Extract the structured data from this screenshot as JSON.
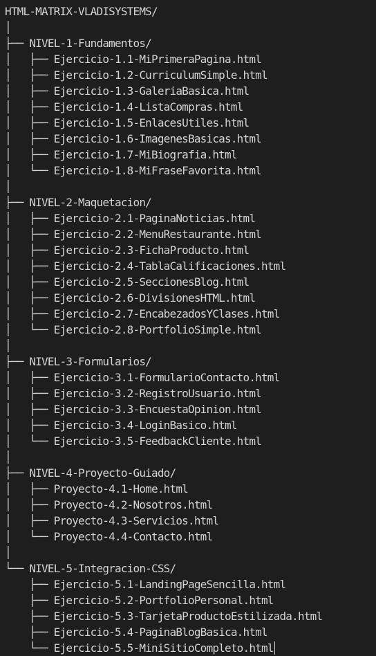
{
  "editor": {
    "theme_background": "#1e1e1e",
    "text_color": "#d4d4d4"
  },
  "tree": {
    "root": "HTML-MATRIX-VLADISYSTEMS/",
    "lines": [
      {
        "kind": "spacer",
        "text": "│"
      },
      {
        "kind": "folder",
        "text": "├── NIVEL-1-Fundamentos/"
      },
      {
        "kind": "file",
        "text": "│   ├── Ejercicio-1.1-MiPrimeraPagina.html"
      },
      {
        "kind": "file",
        "text": "│   ├── Ejercicio-1.2-CurriculumSimple.html"
      },
      {
        "kind": "file",
        "text": "│   ├── Ejercicio-1.3-GaleriaBasica.html"
      },
      {
        "kind": "file",
        "text": "│   ├── Ejercicio-1.4-ListaCompras.html"
      },
      {
        "kind": "file",
        "text": "│   ├── Ejercicio-1.5-EnlacesUtiles.html"
      },
      {
        "kind": "file",
        "text": "│   ├── Ejercicio-1.6-ImagenesBasicas.html"
      },
      {
        "kind": "file",
        "text": "│   ├── Ejercicio-1.7-MiBiografia.html"
      },
      {
        "kind": "file",
        "text": "│   └── Ejercicio-1.8-MiFraseFavorita.html"
      },
      {
        "kind": "spacer",
        "text": "│"
      },
      {
        "kind": "folder",
        "text": "├── NIVEL-2-Maquetacion/"
      },
      {
        "kind": "file",
        "text": "│   ├── Ejercicio-2.1-PaginaNoticias.html"
      },
      {
        "kind": "file",
        "text": "│   ├── Ejercicio-2.2-MenuRestaurante.html"
      },
      {
        "kind": "file",
        "text": "│   ├── Ejercicio-2.3-FichaProducto.html"
      },
      {
        "kind": "file",
        "text": "│   ├── Ejercicio-2.4-TablaCalificaciones.html"
      },
      {
        "kind": "file",
        "text": "│   ├── Ejercicio-2.5-SeccionesBlog.html"
      },
      {
        "kind": "file",
        "text": "│   ├── Ejercicio-2.6-DivisionesHTML.html"
      },
      {
        "kind": "file",
        "text": "│   ├── Ejercicio-2.7-EncabezadosYClases.html"
      },
      {
        "kind": "file",
        "text": "│   └── Ejercicio-2.8-PortfolioSimple.html"
      },
      {
        "kind": "spacer",
        "text": "│"
      },
      {
        "kind": "folder",
        "text": "├── NIVEL-3-Formularios/"
      },
      {
        "kind": "file",
        "text": "│   ├── Ejercicio-3.1-FormularioContacto.html"
      },
      {
        "kind": "file",
        "text": "│   ├── Ejercicio-3.2-RegistroUsuario.html"
      },
      {
        "kind": "file",
        "text": "│   ├── Ejercicio-3.3-EncuestaOpinion.html"
      },
      {
        "kind": "file",
        "text": "│   ├── Ejercicio-3.4-LoginBasico.html"
      },
      {
        "kind": "file",
        "text": "│   └── Ejercicio-3.5-FeedbackCliente.html"
      },
      {
        "kind": "spacer",
        "text": "│"
      },
      {
        "kind": "folder",
        "text": "├── NIVEL-4-Proyecto-Guiado/"
      },
      {
        "kind": "file",
        "text": "│   ├── Proyecto-4.1-Home.html"
      },
      {
        "kind": "file",
        "text": "│   ├── Proyecto-4.2-Nosotros.html"
      },
      {
        "kind": "file",
        "text": "│   ├── Proyecto-4.3-Servicios.html"
      },
      {
        "kind": "file",
        "text": "│   └── Proyecto-4.4-Contacto.html"
      },
      {
        "kind": "spacer",
        "text": "│"
      },
      {
        "kind": "folder",
        "text": "└── NIVEL-5-Integracion-CSS/"
      },
      {
        "kind": "file",
        "text": "    ├── Ejercicio-5.1-LandingPageSencilla.html"
      },
      {
        "kind": "file",
        "text": "    ├── Ejercicio-5.2-PortfolioPersonal.html"
      },
      {
        "kind": "file",
        "text": "    ├── Ejercicio-5.3-TarjetaProductoEstilizada.html"
      },
      {
        "kind": "file",
        "text": "    ├── Ejercicio-5.4-PaginaBlogBasica.html"
      },
      {
        "kind": "file",
        "text": "    └── Ejercicio-5.5-MiniSitioCompleto.html",
        "cursor": true
      }
    ]
  }
}
